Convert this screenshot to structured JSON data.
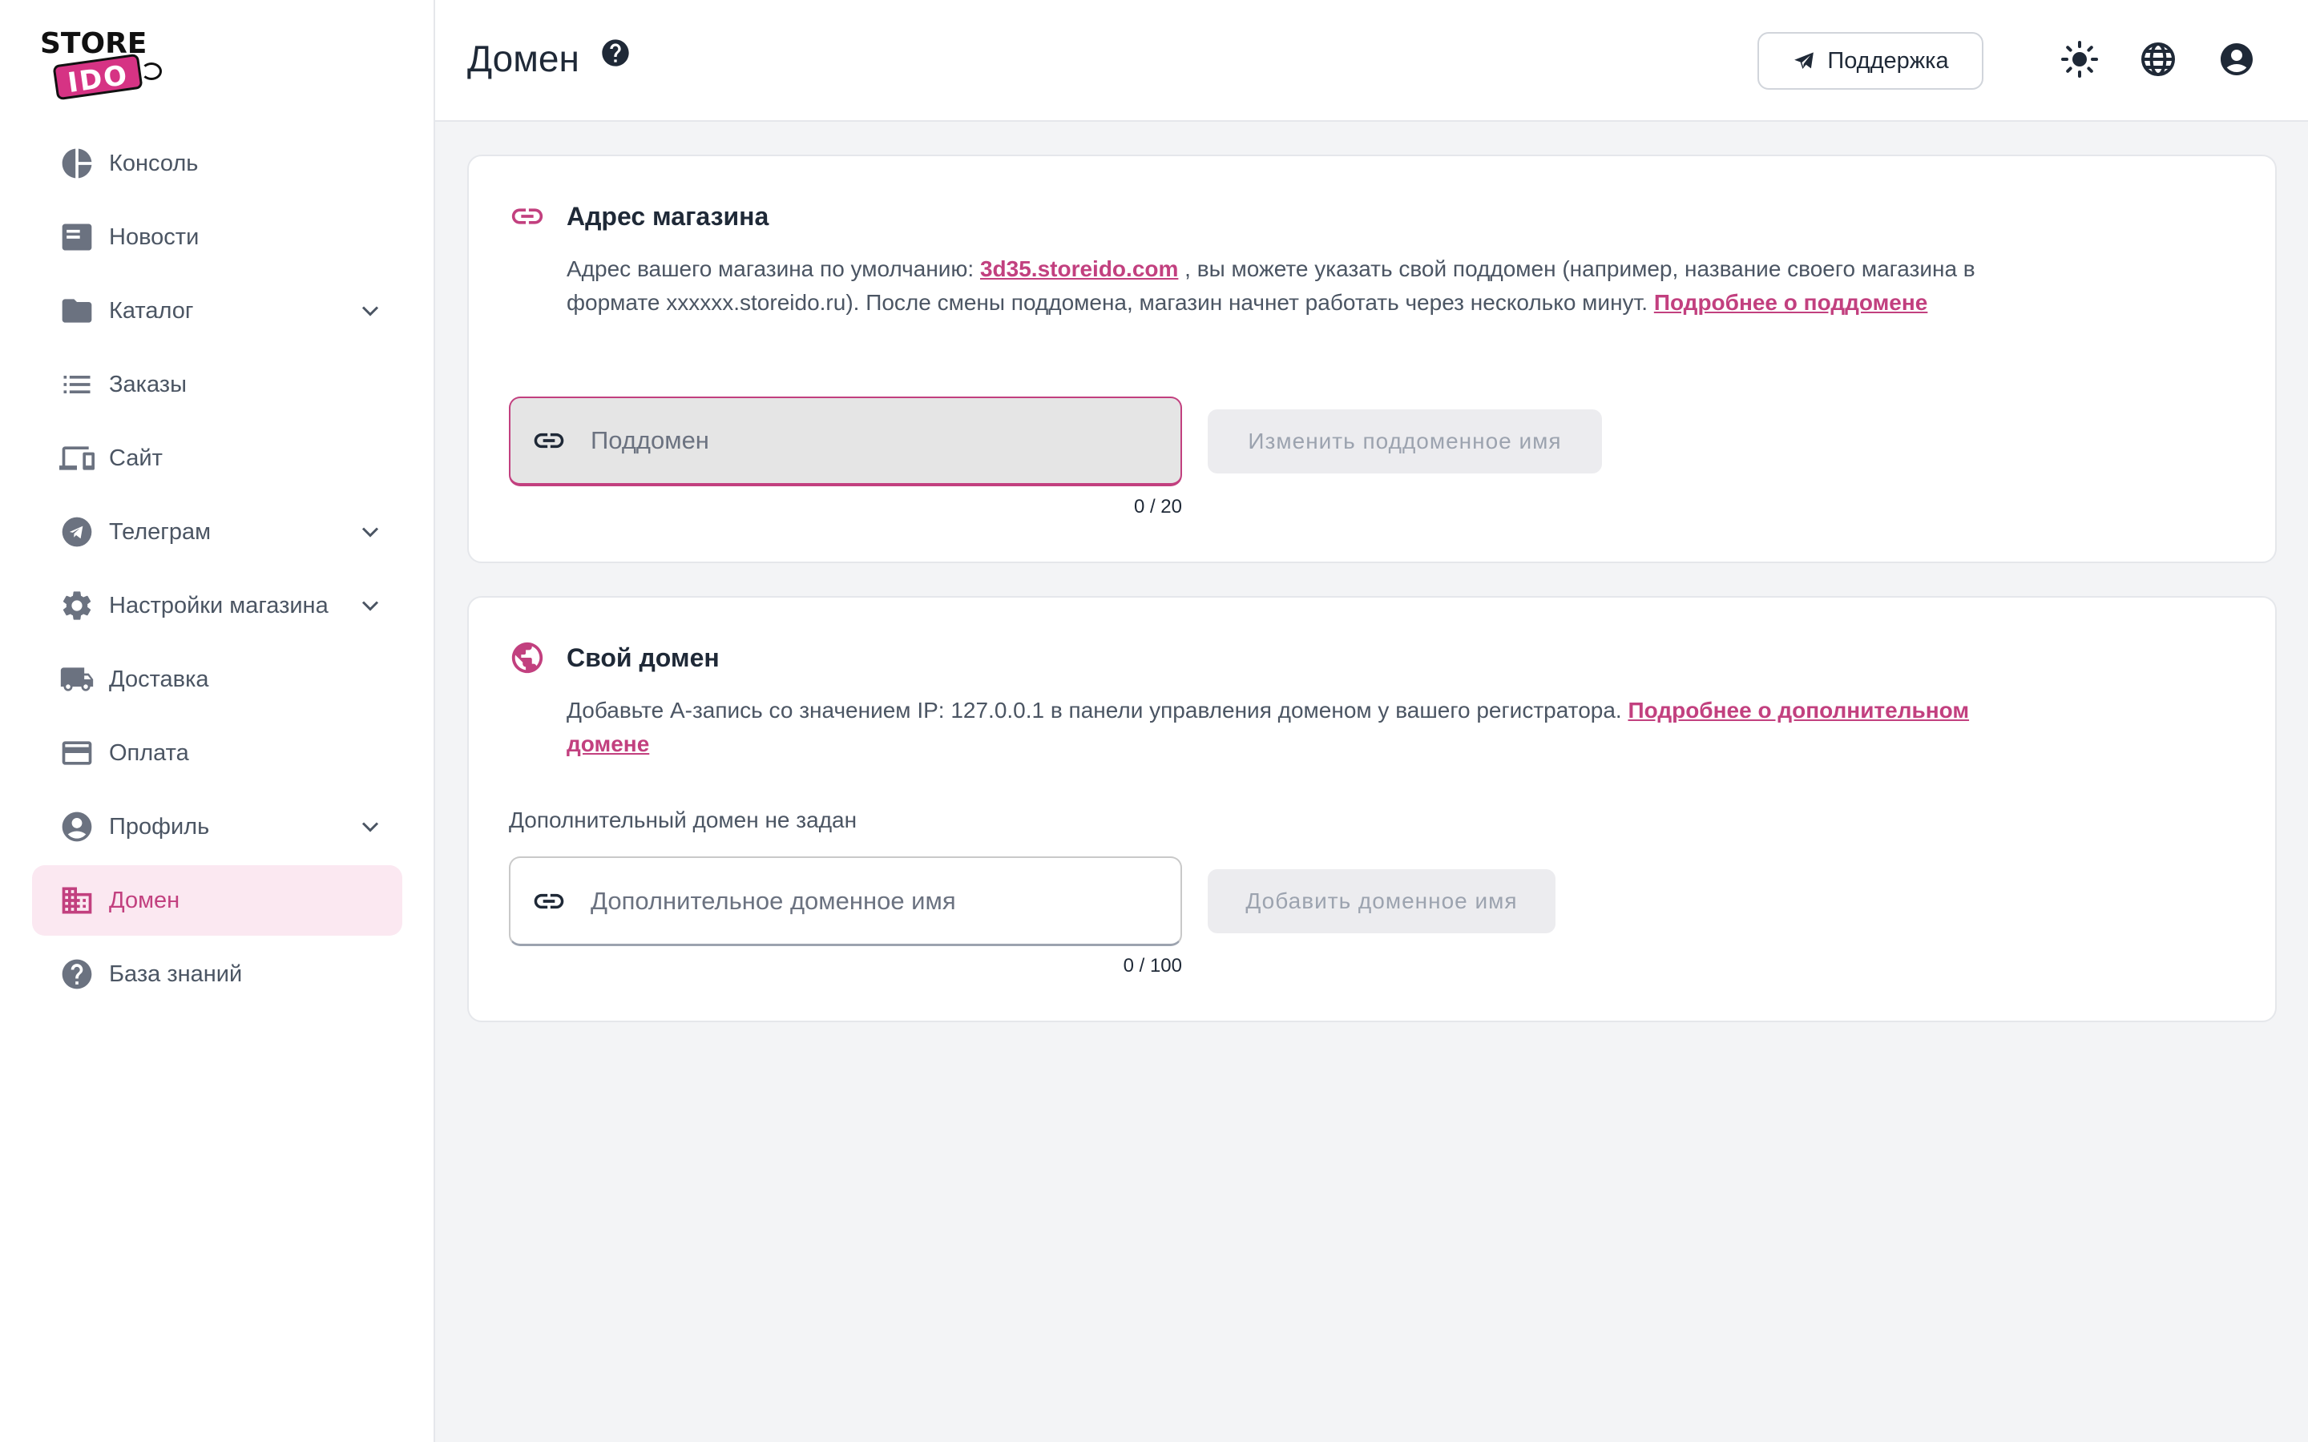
{
  "brand": {
    "logo_top": "STORE",
    "logo_bottom": "IDO",
    "accent_color": "#c2407f"
  },
  "sidebar": {
    "items": [
      {
        "label": "Консоль",
        "icon": "pie-chart-icon",
        "expandable": false,
        "active": false
      },
      {
        "label": "Новости",
        "icon": "news-icon",
        "expandable": false,
        "active": false
      },
      {
        "label": "Каталог",
        "icon": "folder-icon",
        "expandable": true,
        "active": false
      },
      {
        "label": "Заказы",
        "icon": "list-icon",
        "expandable": false,
        "active": false
      },
      {
        "label": "Сайт",
        "icon": "devices-icon",
        "expandable": false,
        "active": false
      },
      {
        "label": "Телеграм",
        "icon": "telegram-icon",
        "expandable": true,
        "active": false
      },
      {
        "label": "Настройки магазина",
        "icon": "gear-icon",
        "expandable": true,
        "active": false
      },
      {
        "label": "Доставка",
        "icon": "truck-icon",
        "expandable": false,
        "active": false
      },
      {
        "label": "Оплата",
        "icon": "credit-card-icon",
        "expandable": false,
        "active": false
      },
      {
        "label": "Профиль",
        "icon": "account-circle-icon",
        "expandable": true,
        "active": false
      },
      {
        "label": "Домен",
        "icon": "domain-building-icon",
        "expandable": false,
        "active": true
      },
      {
        "label": "База знаний",
        "icon": "help-circle-icon",
        "expandable": false,
        "active": false
      }
    ]
  },
  "header": {
    "title": "Домен",
    "help_icon": "help-circle-icon",
    "support_label": "Поддержка",
    "theme_icon": "sun-icon",
    "language_icon": "globe-icon",
    "account_icon": "account-circle-icon"
  },
  "store_address": {
    "title": "Адрес магазина",
    "icon": "link-icon",
    "text_before": "Адрес вашего магазина по умолчанию: ",
    "default_address": "3d35.storeido.com",
    "text_after": " , вы можете указать свой поддомен (например, название своего магазина в формате xxxxxx.storeido.ru). После смены поддомена, магазин начнет работать через несколько минут. ",
    "more_link": "Подробнее о поддомене",
    "input_placeholder": "Поддомен",
    "input_value": "",
    "counter": "0 / 20",
    "button_label": "Изменить поддоменное имя"
  },
  "custom_domain": {
    "title": "Свой домен",
    "icon": "globe-icon",
    "text": "Добавьте A-запись со значением IP: 127.0.0.1 в панели управления доменом у вашего регистратора. ",
    "more_link": "Подробнее о дополнительном домене",
    "status": "Дополнительный домен не задан",
    "input_placeholder": "Дополнительное доменное имя",
    "input_value": "",
    "counter": "0 / 100",
    "button_label": "Добавить доменное имя"
  }
}
